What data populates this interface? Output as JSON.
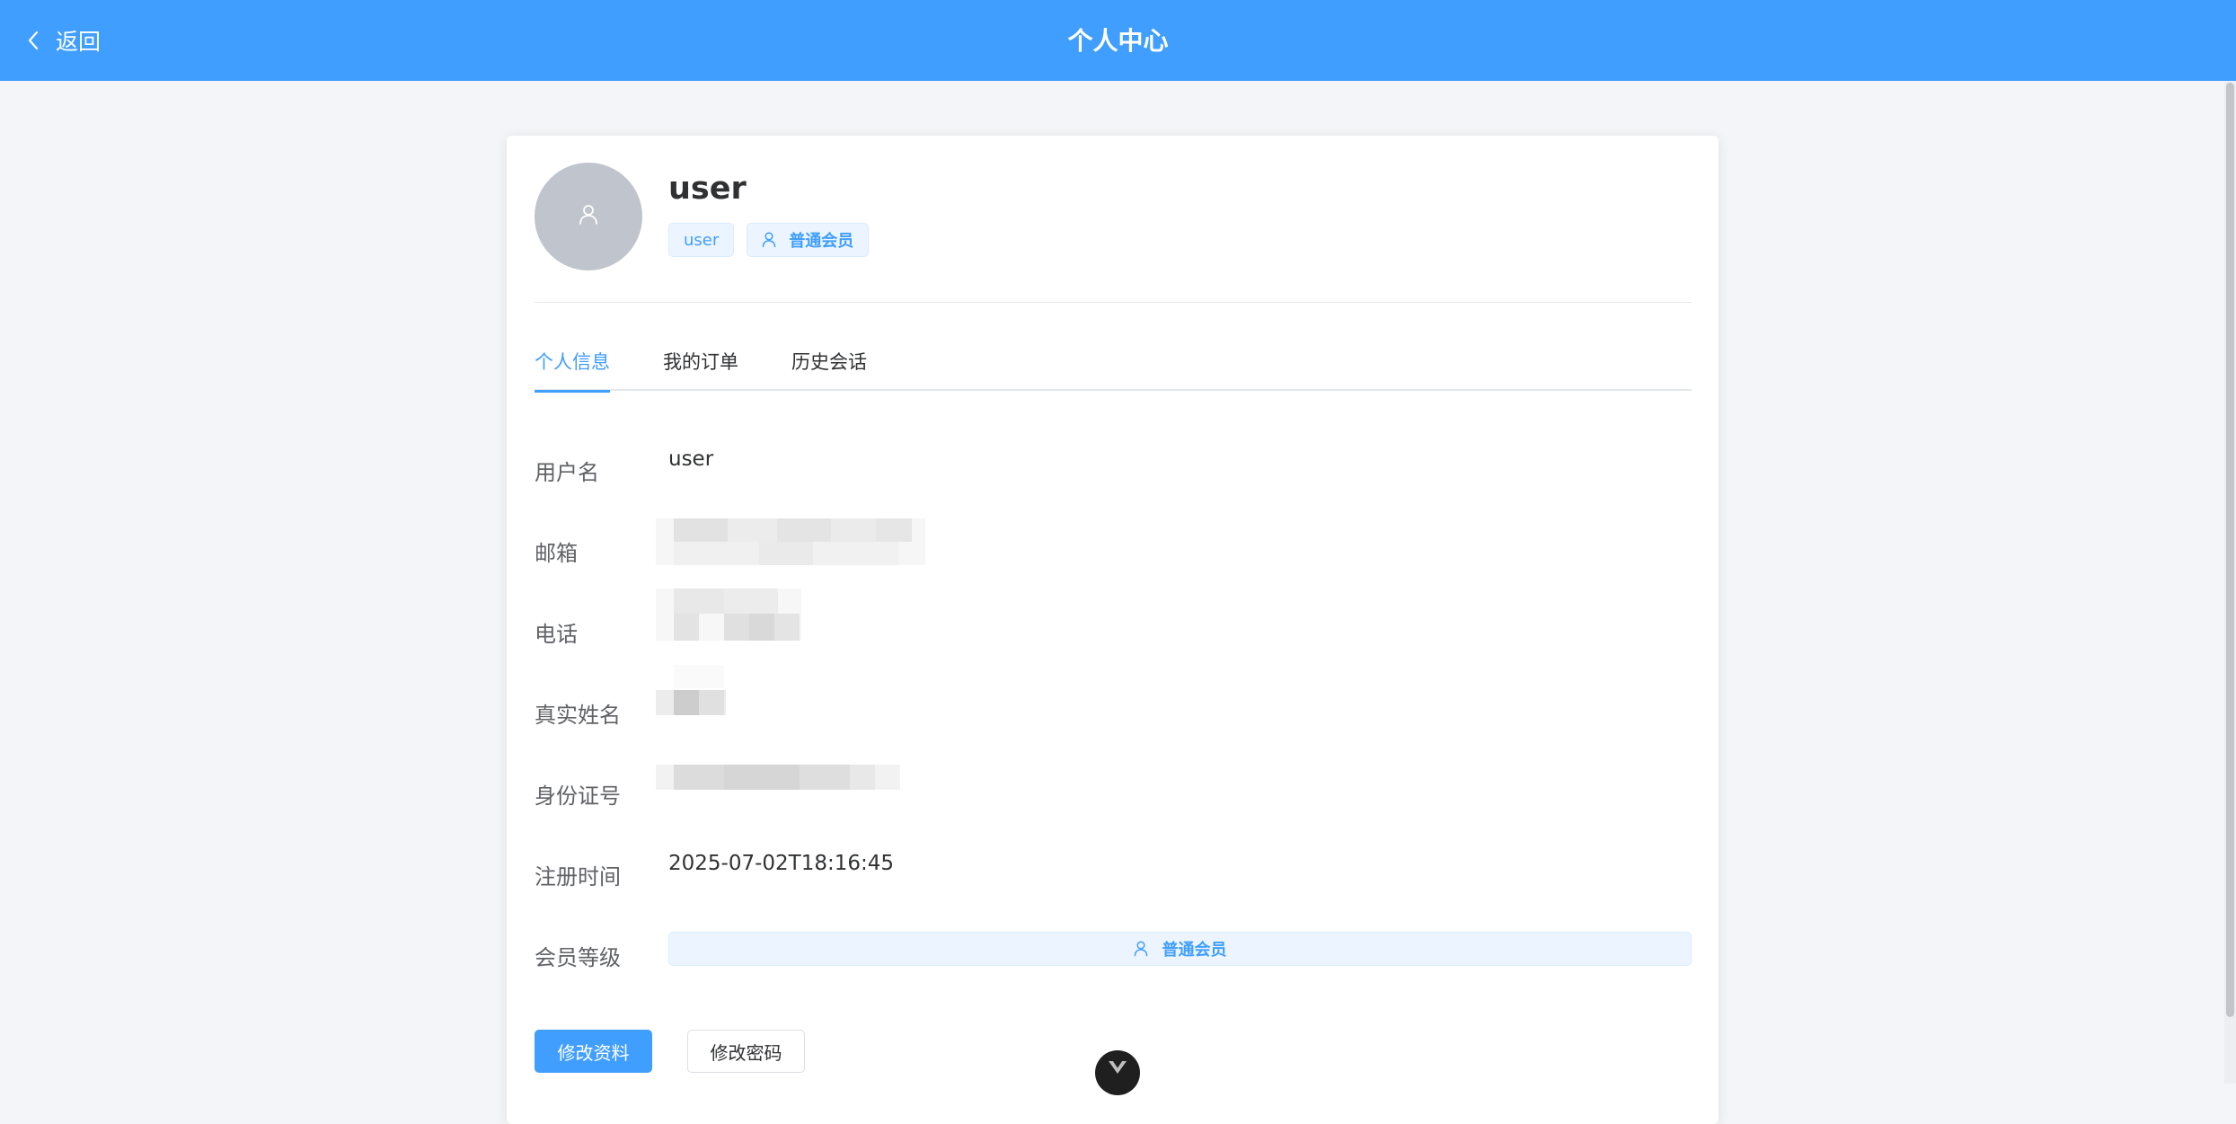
{
  "header": {
    "back_label": "返回",
    "title": "个人中心",
    "background": "#409eff"
  },
  "profile": {
    "avatar_icon": "user-icon",
    "username": "user",
    "role_tag": "user",
    "member_tag": "普通会员"
  },
  "tabs": [
    {
      "label": "个人信息",
      "active": true
    },
    {
      "label": "我的订单",
      "active": false
    },
    {
      "label": "历史会话",
      "active": false
    }
  ],
  "info": {
    "username_label": "用户名",
    "username_value": "user",
    "email_label": "邮箱",
    "phone_label": "电话",
    "realname_label": "真实姓名",
    "idcard_label": "身份证号",
    "register_time_label": "注册时间",
    "register_time_value": "2025-07-02T18:16:45",
    "member_level_label": "会员等级",
    "member_level_value": "普通会员"
  },
  "buttons": {
    "edit_profile": "修改资料",
    "change_password": "修改密码"
  },
  "colors": {
    "primary": "#409eff",
    "tag_bg": "#ecf5ff",
    "page_bg": "#f3f5f8"
  }
}
